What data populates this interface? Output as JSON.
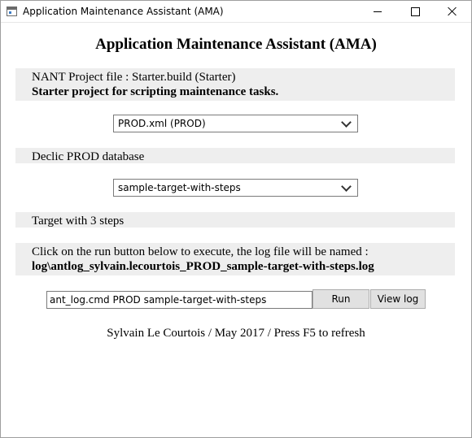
{
  "window": {
    "title": "Application Maintenance Assistant (AMA)"
  },
  "page": {
    "title": "Application Maintenance Assistant (AMA)"
  },
  "project": {
    "file_line": "NANT Project file : Starter.build (Starter)",
    "description": "Starter project for scripting maintenance tasks."
  },
  "environment_select": {
    "selected": "PROD.xml (PROD)"
  },
  "database_line": "Declic PROD database",
  "target_select": {
    "selected": "sample-target-with-steps"
  },
  "target_info": "Target with 3 steps",
  "run_info": {
    "line1": "Click on the run button below to execute, the log file will be named :",
    "log_name": "log\\antlog_sylvain.lecourtois_PROD_sample-target-with-steps.log"
  },
  "command": {
    "value": "ant_log.cmd PROD sample-target-with-steps"
  },
  "buttons": {
    "run": "Run",
    "view_log": "View log"
  },
  "footer": "Sylvain Le Courtois / May 2017 / Press F5 to refresh",
  "icons": {
    "app": "app-window-icon",
    "minimize": "minimize-icon",
    "maximize": "maximize-icon",
    "close": "close-icon",
    "dropdown": "chevron-down-icon"
  }
}
